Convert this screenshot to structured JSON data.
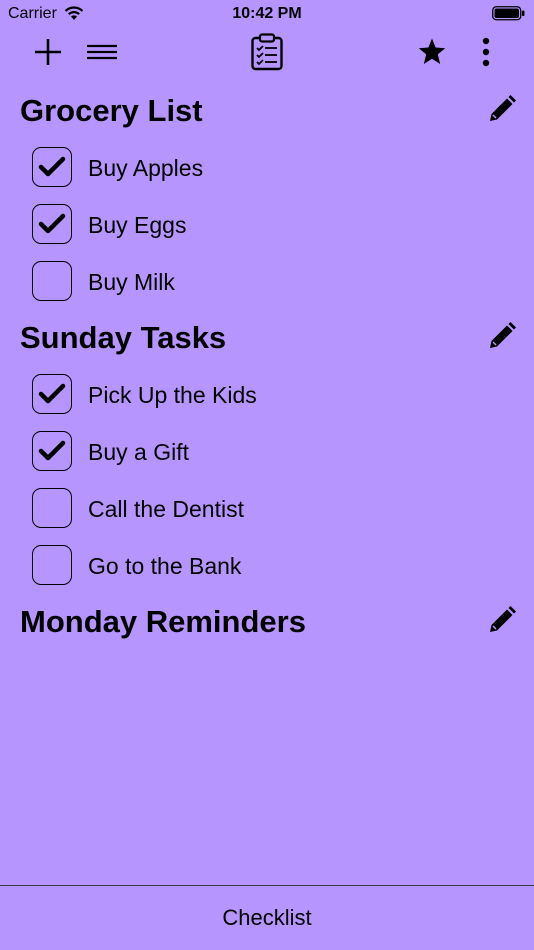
{
  "status_bar": {
    "carrier": "Carrier",
    "time": "10:42 PM",
    "battery_level": 1.0
  },
  "toolbar": {
    "icons": [
      "plus-icon",
      "menu-icon",
      "clipboard-checklist-icon",
      "star-icon",
      "more-vertical-icon"
    ]
  },
  "sections": [
    {
      "title": "Grocery List",
      "items": [
        {
          "label": "Buy Apples",
          "checked": true
        },
        {
          "label": "Buy Eggs",
          "checked": true
        },
        {
          "label": "Buy Milk",
          "checked": false
        }
      ]
    },
    {
      "title": "Sunday Tasks",
      "items": [
        {
          "label": "Pick Up the Kids",
          "checked": true
        },
        {
          "label": "Buy a Gift",
          "checked": true
        },
        {
          "label": "Call the Dentist",
          "checked": false
        },
        {
          "label": "Go to the Bank",
          "checked": false
        }
      ]
    },
    {
      "title": "Monday Reminders",
      "items": []
    }
  ],
  "bottom_bar": {
    "title": "Checklist"
  },
  "colors": {
    "background": "#b795ff",
    "foreground": "#000000"
  }
}
